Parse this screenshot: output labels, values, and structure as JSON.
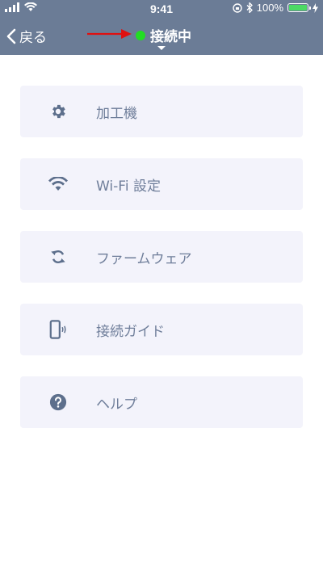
{
  "status_bar": {
    "time": "9:41",
    "battery_percent": "100%",
    "battery_level": 1.0,
    "signal_bars": 4
  },
  "nav": {
    "back_label": "戻る",
    "connection_status": "接続中",
    "status_color": "#22dd22"
  },
  "menu": {
    "items": [
      {
        "label": "加工機",
        "icon": "gear-icon"
      },
      {
        "label": "Wi-Fi 設定",
        "icon": "wifi-icon"
      },
      {
        "label": "ファームウェア",
        "icon": "sync-icon"
      },
      {
        "label": "接続ガイド",
        "icon": "phone-vibrate-icon"
      },
      {
        "label": "ヘルプ",
        "icon": "question-circle-icon"
      }
    ]
  },
  "colors": {
    "header": "#6b7c96",
    "item_background": "#f3f3fb",
    "item_text": "#6f7e9a",
    "annotation_arrow": "#e01010"
  }
}
